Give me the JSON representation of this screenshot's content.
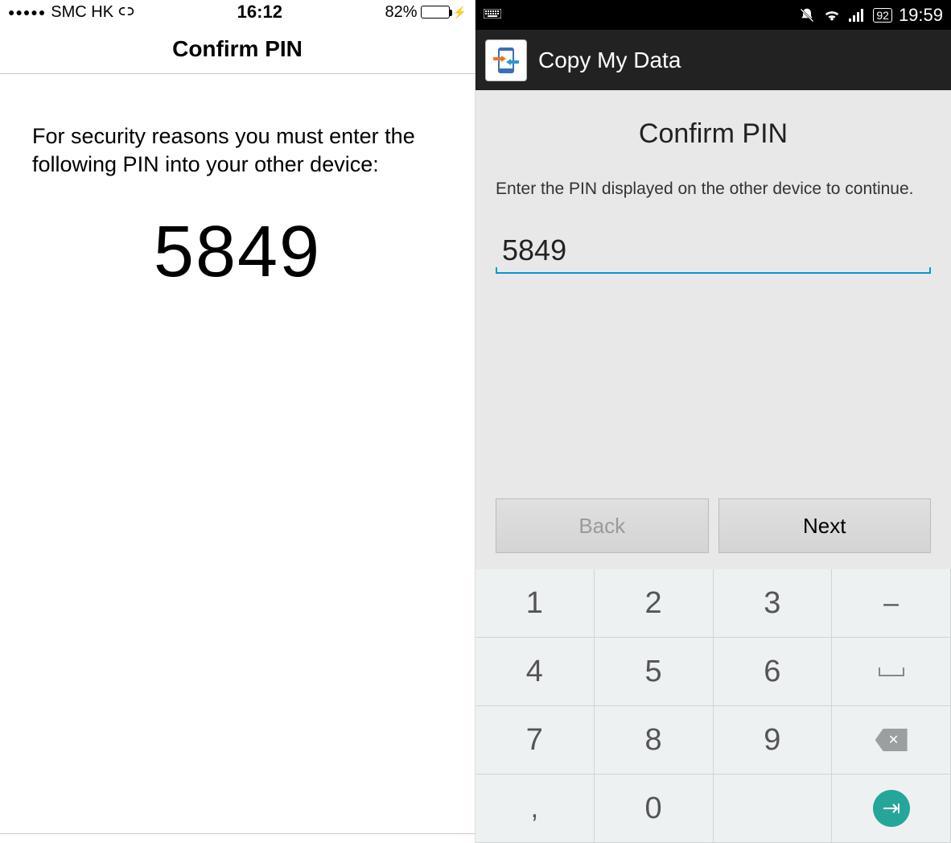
{
  "ios": {
    "status": {
      "signal_dots": "●●●●●",
      "carrier": "SMC HK",
      "time": "16:12",
      "battery_pct": "82%",
      "battery_fill_pct": 82
    },
    "navbar_title": "Confirm PIN",
    "instruction": "For security reasons you must enter the following PIN into your other device:",
    "pin": "5849"
  },
  "android": {
    "status": {
      "battery_level": "92",
      "time": "19:59"
    },
    "app_title": "Copy My Data",
    "title": "Confirm PIN",
    "instruction": "Enter the PIN displayed on the other device to continue.",
    "input_value": "5849",
    "buttons": {
      "back": "Back",
      "next": "Next"
    },
    "keypad": {
      "k1": "1",
      "k2": "2",
      "k3": "3",
      "k4": "4",
      "k5": "5",
      "k6": "6",
      "k7": "7",
      "k8": "8",
      "k9": "9",
      "k0": "0",
      "dash": "–",
      "space": "⎵",
      "comma": ","
    }
  }
}
